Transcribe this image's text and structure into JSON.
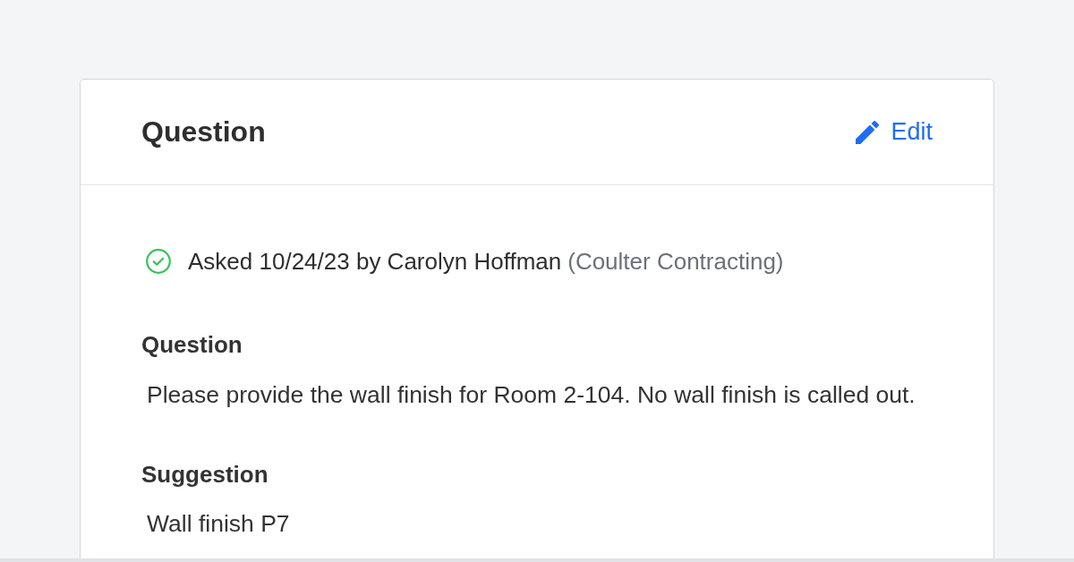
{
  "card": {
    "title": "Question",
    "edit_link": {
      "label": "Edit"
    }
  },
  "status": {
    "text": "Asked 10/24/23 by Carolyn Hoffman",
    "company": "(Coulter Contracting)"
  },
  "sections": [
    {
      "heading": "Question",
      "text": "Please provide the wall finish for Room 2-104. No wall finish is called out."
    },
    {
      "heading": "Suggestion",
      "text": "Wall finish P7"
    }
  ]
}
